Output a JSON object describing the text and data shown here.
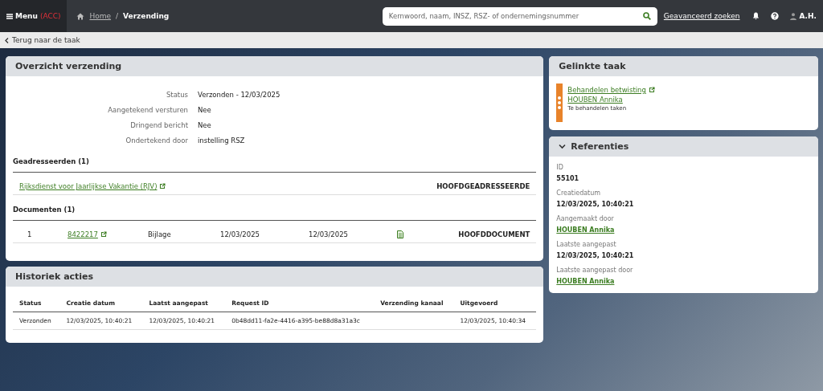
{
  "topbar": {
    "menu_label": "Menu",
    "env": "(ACC)",
    "breadcrumb_separator": "/",
    "breadcrumb": [
      {
        "label": "Home",
        "link": true
      },
      {
        "label": "Verzending",
        "link": false
      }
    ],
    "search": {
      "placeholder": "Kernwoord, naam, INSZ, RSZ- of ondernemingsnummer"
    },
    "advanced_search": "Geavanceerd zoeken",
    "user": "A.H."
  },
  "back_link": "Terug naar de taak",
  "overview": {
    "title": "Overzicht verzending",
    "fields": [
      {
        "label": "Status",
        "value": "Verzonden - 12/03/2025"
      },
      {
        "label": "Aangetekend versturen",
        "value": "Nee"
      },
      {
        "label": "Dringend bericht",
        "value": "Nee"
      },
      {
        "label": "Ondertekend door",
        "value": "instelling RSZ"
      }
    ],
    "addressees": {
      "title": "Geadresseerden (1)",
      "rows": [
        {
          "name": "Rijksdienst voor Jaarlijkse Vakantie (RJV)",
          "role": "HOOFDGEADRESSEERDE"
        }
      ]
    },
    "documents": {
      "title": "Documenten (1)",
      "rows": [
        {
          "number": "1",
          "id": "8422217",
          "type": "Bijlage",
          "date_1": "12/03/2025",
          "date_2": "12/03/2025",
          "role": "HOOFDDOCUMENT"
        }
      ]
    }
  },
  "history": {
    "title": "Historiek acties",
    "columns": [
      "Status",
      "Creatie datum",
      "Laatst aangepast",
      "Request ID",
      "Verzending kanaal",
      "Uitgevoerd"
    ],
    "rows": [
      [
        "Verzonden",
        "12/03/2025, 10:40:21",
        "12/03/2025, 10:40:21",
        "0b48dd11-fa2e-4416-a395-be88d8a31a3c",
        "",
        "12/03/2025, 10:40:34"
      ]
    ]
  },
  "linked_task": {
    "title": "Gelinkte taak",
    "task": "Behandelen betwisting",
    "person": "HOUBEN Annika",
    "status": "Te behandelen taken",
    "color": "#e8832a"
  },
  "references": {
    "title": "Referenties",
    "expanded": true,
    "items": [
      {
        "label": "ID",
        "value": "55101",
        "link": false
      },
      {
        "label": "Creatiedatum",
        "value": "12/03/2025, 10:40:21",
        "link": false
      },
      {
        "label": "Aangemaakt door",
        "value": "HOUBEN Annika",
        "link": true
      },
      {
        "label": "Laatste aangepast",
        "value": "12/03/2025, 10:40:21",
        "link": false
      },
      {
        "label": "Laatste aangepast door",
        "value": "HOUBEN Annika",
        "link": true
      }
    ]
  }
}
